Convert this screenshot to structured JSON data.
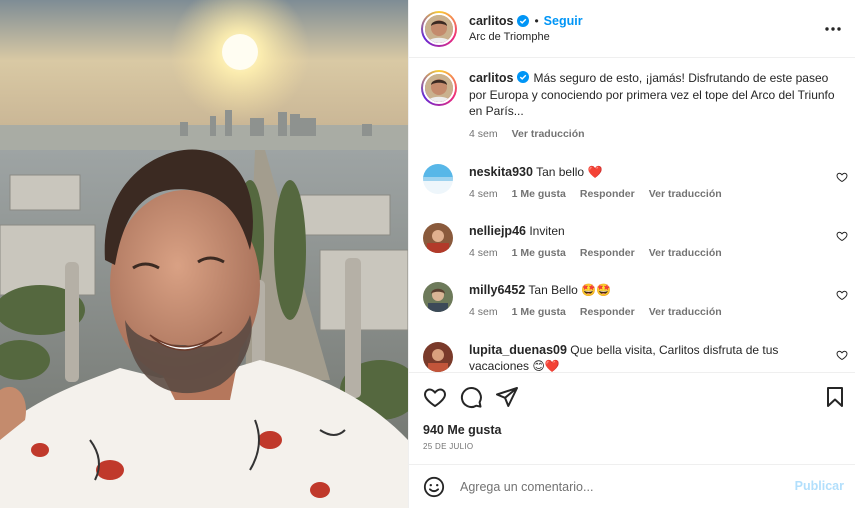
{
  "post": {
    "author": "carlitos",
    "follow_label": "Seguir",
    "dot": "•",
    "location": "Arc de Triomphe"
  },
  "caption": {
    "author": "carlitos",
    "text": "Más seguro de esto, ¡jamás! Disfrutando de este paseo por Europa y conociendo por primera vez el tope del Arco del Triunfo en París...",
    "time": "4 sem",
    "translate": "Ver traducción"
  },
  "comments": [
    {
      "user": "neskita930",
      "text": "Tan bello",
      "emoji": "❤️",
      "time": "4 sem",
      "likes": "1 Me gusta",
      "reply": "Responder",
      "translate": "Ver traducción"
    },
    {
      "user": "nelliejp46",
      "text": "Inviten",
      "emoji": "",
      "time": "4 sem",
      "likes": "1 Me gusta",
      "reply": "Responder",
      "translate": "Ver traducción"
    },
    {
      "user": "milly6452",
      "text": "Tan Bello",
      "emoji": "🤩🤩",
      "time": "4 sem",
      "likes": "1 Me gusta",
      "reply": "Responder",
      "translate": "Ver traducción"
    },
    {
      "user": "lupita_duenas09",
      "text": "Que bella visita, Carlitos disfruta de tus vacaciones",
      "emoji": "😊❤️",
      "time": "",
      "likes": "",
      "reply": "",
      "translate": ""
    }
  ],
  "actions": {
    "likes": "940 Me gusta",
    "date": "25 DE JULIO"
  },
  "composer": {
    "placeholder": "Agrega un comentario...",
    "publish": "Publicar"
  },
  "icons": {
    "verified": "verified-badge-icon",
    "more": "more-options-icon",
    "like": "heart-icon",
    "comment": "comment-icon",
    "share": "share-icon",
    "save": "bookmark-icon",
    "emoji": "emoji-icon"
  },
  "colors": {
    "accent": "#0095f6",
    "verified": "#0095f6",
    "muted": "#737373",
    "publish_disabled": "#b2dffc",
    "heart_red": "#ed1c24"
  }
}
